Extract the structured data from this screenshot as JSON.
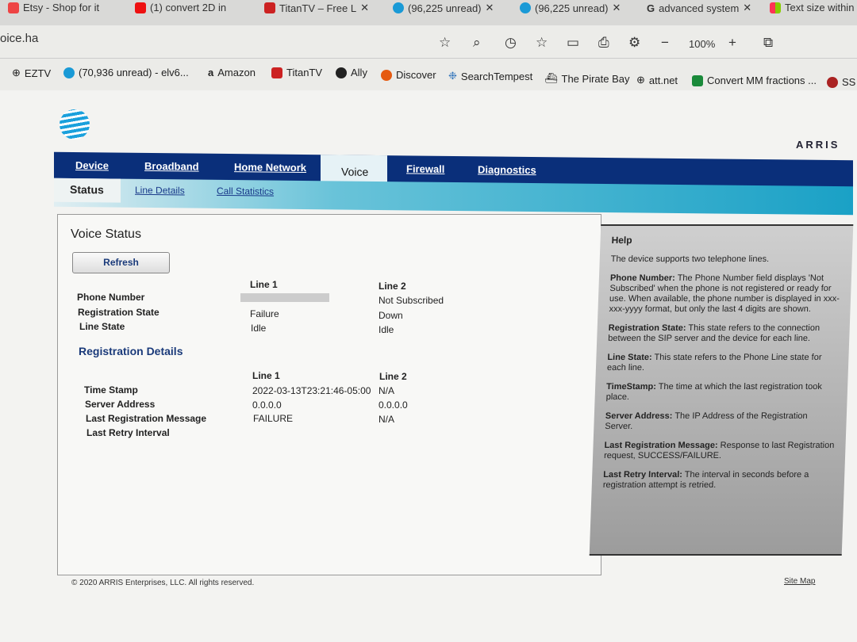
{
  "browser": {
    "tabs": [
      "Etsy - Shop for it",
      "(1) convert 2D in",
      "TitanTV – Free L",
      "(96,225 unread)",
      "(96,225 unread)",
      "advanced system",
      "Text size within"
    ],
    "url": "oice.ha",
    "zoom": "100%",
    "toolbar_icons": [
      "star-icon",
      "search-icon",
      "history-icon",
      "favorites-icon",
      "split-icon",
      "print-icon",
      "gear-icon",
      "zoom-out-icon",
      "zoom-in-icon",
      "collections-icon"
    ],
    "bookmarks": [
      "EZTV",
      "(70,936 unread) - elv6...",
      "Amazon",
      "TitanTV",
      "Ally",
      "Discover",
      "SearchTempest",
      "The Pirate Bay",
      "att.net",
      "Convert MM fractions ...",
      "SS"
    ]
  },
  "brand": {
    "logo": "AT&T",
    "vendor": "ARRIS"
  },
  "nav": {
    "tabs": [
      "Device",
      "Broadband",
      "Home Network",
      "Voice",
      "Firewall",
      "Diagnostics"
    ],
    "active": "Voice",
    "subtabs": [
      "Status",
      "Line Details",
      "Call Statistics"
    ],
    "active_sub": "Status"
  },
  "voice_status": {
    "title": "Voice Status",
    "refresh": "Refresh",
    "columns": [
      "Line 1",
      "Line 2"
    ],
    "rows": [
      {
        "label": "Phone Number",
        "line1": "",
        "line2": "Not Subscribed"
      },
      {
        "label": "Registration State",
        "line1": "Failure",
        "line2": "Down"
      },
      {
        "label": "Line State",
        "line1": "Idle",
        "line2": "Idle"
      }
    ]
  },
  "registration_details": {
    "title": "Registration Details",
    "columns": [
      "Line 1",
      "Line 2"
    ],
    "rows": [
      {
        "label": "Time Stamp",
        "line1": "2022-03-13T23:21:46-05:00",
        "line2": "N/A"
      },
      {
        "label": "Server Address",
        "line1": "0.0.0.0",
        "line2": "0.0.0.0"
      },
      {
        "label": "Last Registration Message",
        "line1": "FAILURE",
        "line2": "N/A"
      },
      {
        "label": "Last Retry Interval",
        "line1": "",
        "line2": ""
      }
    ]
  },
  "help": {
    "title": "Help",
    "intro": "The device supports two telephone lines.",
    "items": [
      {
        "term": "Phone Number:",
        "text": " The Phone Number field displays 'Not Subscribed' when the phone is not registered or ready for use. When available, the phone number is displayed in xxx-xxx-yyyy format, but only the last 4 digits are shown."
      },
      {
        "term": "Registration State:",
        "text": " This state refers to the connection between the SIP server and the device for each line."
      },
      {
        "term": "Line State:",
        "text": " This state refers to the Phone Line state for each line."
      },
      {
        "term": "TimeStamp:",
        "text": " The time at which the last registration took place."
      },
      {
        "term": "Server Address:",
        "text": " The IP Address of the Registration Server."
      },
      {
        "term": "Last Registration Message:",
        "text": " Response to last Registration request, SUCCESS/FAILURE."
      },
      {
        "term": "Last Retry Interval:",
        "text": " The interval in seconds before a registration attempt is retried."
      }
    ]
  },
  "footer": {
    "copyright": "© 2020 ARRIS Enterprises, LLC. All rights reserved.",
    "site_map": "Site Map"
  }
}
